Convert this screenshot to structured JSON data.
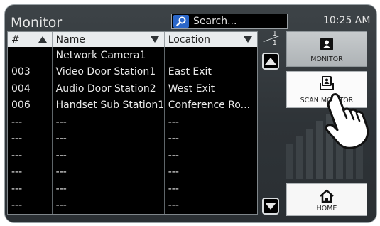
{
  "header": {
    "title": "Monitor",
    "search_placeholder": "Search...",
    "clock": "10:25 AM"
  },
  "table": {
    "columns": [
      {
        "label": "#",
        "sort": "up"
      },
      {
        "label": "Name",
        "sort": "down"
      },
      {
        "label": "Location",
        "sort": "down"
      }
    ],
    "rows": [
      {
        "num": "",
        "name": "Network Camera1",
        "location": ""
      },
      {
        "num": "003",
        "name": "Video Door Station1",
        "location": "East Exit"
      },
      {
        "num": "004",
        "name": "Audio Door Station2",
        "location": "West Exit"
      },
      {
        "num": "006",
        "name": "Handset Sub Station1",
        "location": "Conference Ro..."
      },
      {
        "num": "---",
        "name": "---",
        "location": "---"
      },
      {
        "num": "---",
        "name": "---",
        "location": "---"
      },
      {
        "num": "---",
        "name": "---",
        "location": "---"
      },
      {
        "num": "---",
        "name": "---",
        "location": "---"
      },
      {
        "num": "---",
        "name": "---",
        "location": "---"
      },
      {
        "num": "---",
        "name": "---",
        "location": "---"
      }
    ]
  },
  "pager": {
    "current": "1",
    "total": "1"
  },
  "side_buttons": {
    "monitor": "MONITOR",
    "scan_monitor": "SCAN MONITOR",
    "home": "HOME"
  },
  "colors": {
    "accent": "#2b67c9",
    "panel": "#33393d",
    "list_bg": "#000000"
  }
}
